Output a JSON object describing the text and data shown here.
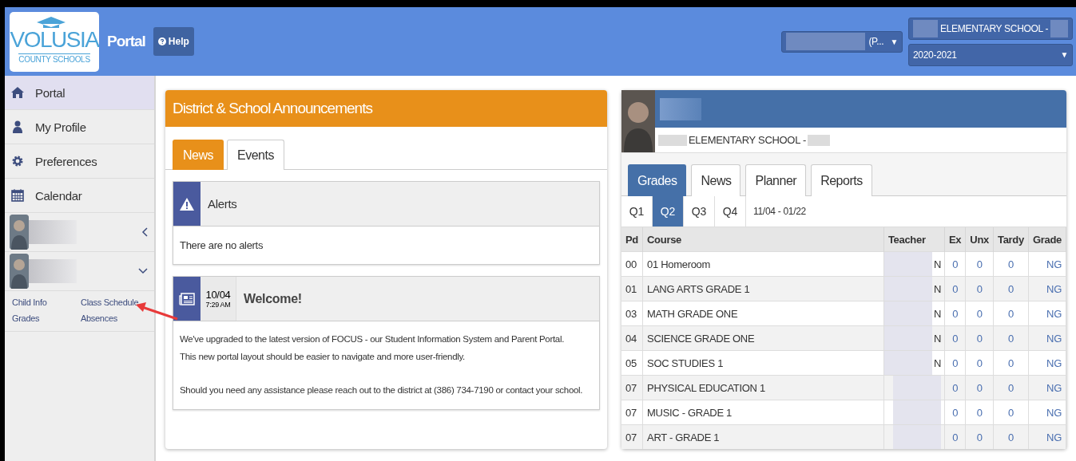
{
  "header": {
    "logo": {
      "line1": "VOLUSIA",
      "line2": "COUNTY SCHOOLS"
    },
    "title": "Portal",
    "help": "Help",
    "user_select": {
      "value": "(P...",
      "caret": "▼"
    },
    "school_select": {
      "value": "ELEMENTARY SCHOOL -"
    },
    "year_select": {
      "value": "2020-2021",
      "caret": "▼"
    }
  },
  "sidebar": {
    "items": [
      {
        "label": "Portal",
        "kind": "home",
        "selected": true
      },
      {
        "label": "My Profile",
        "kind": "profile",
        "selected": false
      },
      {
        "label": "Preferences",
        "kind": "preferences",
        "selected": false
      },
      {
        "label": "Calendar",
        "kind": "calendar",
        "selected": false
      }
    ],
    "students": [
      {
        "expanded": false
      },
      {
        "expanded": true,
        "links": [
          {
            "label": "Child Info"
          },
          {
            "label": "Class Schedule"
          },
          {
            "label": "Grades"
          },
          {
            "label": "Absences"
          }
        ]
      }
    ]
  },
  "announcements": {
    "title": "District & School Announcements",
    "tabs": [
      {
        "label": "News",
        "selected": true
      },
      {
        "label": "Events",
        "selected": false
      }
    ],
    "alerts": {
      "title": "Alerts",
      "text": "There are no alerts"
    },
    "posts": [
      {
        "date": "10/04",
        "time": "7:29 AM",
        "title": "Welcome!",
        "paragraphs": [
          "We've upgraded to the latest version of FOCUS - our Student Information System and Parent Portal.",
          "This new portal layout should be easier to navigate and more user-friendly.",
          "Should you need any assistance please reach out to the district at (386) 734-7190 or contact your school."
        ]
      }
    ]
  },
  "student": {
    "school": "ELEMENTARY SCHOOL -",
    "tabs": [
      {
        "label": "Grades",
        "selected": true
      },
      {
        "label": "News",
        "selected": false
      },
      {
        "label": "Planner",
        "selected": false
      },
      {
        "label": "Reports",
        "selected": false
      }
    ],
    "quarters": [
      {
        "label": "Q1",
        "selected": false
      },
      {
        "label": "Q2",
        "selected": true
      },
      {
        "label": "Q3",
        "selected": false
      },
      {
        "label": "Q4",
        "selected": false
      }
    ],
    "date_range": "11/04 - 01/22",
    "columns": [
      "Pd",
      "Course",
      "Teacher",
      "Ex",
      "Unx",
      "Tardy",
      "Grade"
    ],
    "rows": [
      {
        "pd": "00",
        "course": "01 Homeroom",
        "teacher": "N",
        "ex": "0",
        "unx": "0",
        "tardy": "0",
        "grade": "NG"
      },
      {
        "pd": "01",
        "course": "LANG ARTS GRADE 1",
        "teacher": "N",
        "ex": "0",
        "unx": "0",
        "tardy": "0",
        "grade": "NG"
      },
      {
        "pd": "03",
        "course": "MATH GRADE ONE",
        "teacher": "N",
        "ex": "0",
        "unx": "0",
        "tardy": "0",
        "grade": "NG"
      },
      {
        "pd": "04",
        "course": "SCIENCE GRADE ONE",
        "teacher": "N",
        "ex": "0",
        "unx": "0",
        "tardy": "0",
        "grade": "NG"
      },
      {
        "pd": "05",
        "course": "SOC STUDIES 1",
        "teacher": "N",
        "ex": "0",
        "unx": "0",
        "tardy": "0",
        "grade": "NG"
      },
      {
        "pd": "07",
        "course": "PHYSICAL EDUCATION 1",
        "ex": "0",
        "unx": "0",
        "tardy": "0",
        "grade": "NG"
      },
      {
        "pd": "07",
        "course": "MUSIC - GRADE 1",
        "ex": "0",
        "unx": "0",
        "tardy": "0",
        "grade": "NG"
      },
      {
        "pd": "07",
        "course": "ART - GRADE 1",
        "ex": "0",
        "unx": "0",
        "tardy": "0",
        "grade": "NG"
      }
    ]
  }
}
